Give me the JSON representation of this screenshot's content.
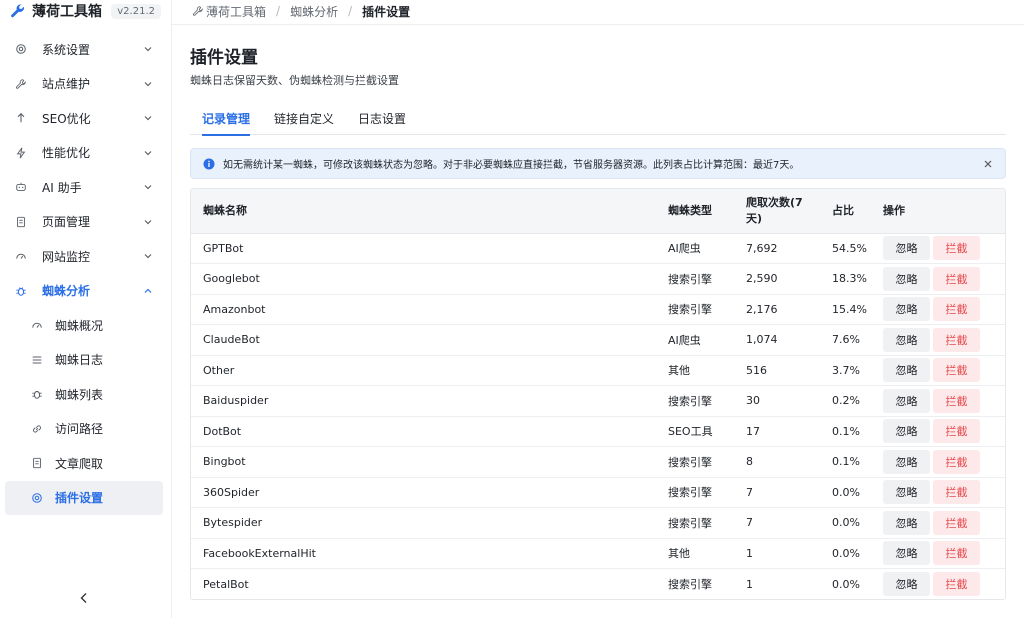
{
  "app": {
    "title": "薄荷工具箱",
    "version": "v2.21.2"
  },
  "sidebar": {
    "items": [
      {
        "label": "系统设置",
        "icon": "gear-icon"
      },
      {
        "label": "站点维护",
        "icon": "wrench-icon"
      },
      {
        "label": "SEO优化",
        "icon": "arrow-up-icon"
      },
      {
        "label": "性能优化",
        "icon": "bolt-icon"
      },
      {
        "label": "AI 助手",
        "icon": "robot-icon"
      },
      {
        "label": "页面管理",
        "icon": "page-icon"
      },
      {
        "label": "网站监控",
        "icon": "gauge-icon"
      },
      {
        "label": "蜘蛛分析",
        "icon": "bug-icon"
      }
    ],
    "sub_items": [
      {
        "label": "蜘蛛概况",
        "icon": "gauge-icon"
      },
      {
        "label": "蜘蛛日志",
        "icon": "list-icon"
      },
      {
        "label": "蜘蛛列表",
        "icon": "bug-icon"
      },
      {
        "label": "访问路径",
        "icon": "link-icon"
      },
      {
        "label": "文章爬取",
        "icon": "document-icon"
      },
      {
        "label": "插件设置",
        "icon": "gear-icon"
      }
    ]
  },
  "breadcrumb": {
    "root": "薄荷工具箱",
    "parent": "蜘蛛分析",
    "current": "插件设置"
  },
  "page": {
    "title": "插件设置",
    "subtitle": "蜘蛛日志保留天数、伪蜘蛛检测与拦截设置"
  },
  "tabs": [
    "记录管理",
    "链接自定义",
    "日志设置"
  ],
  "notice": "如无需统计某一蜘蛛，可修改该蜘蛛状态为忽略。对于非必要蜘蛛应直接拦截，节省服务器资源。此列表占比计算范围：最近7天。",
  "table": {
    "headers": {
      "name": "蜘蛛名称",
      "type": "蜘蛛类型",
      "count": "爬取次数(7天)",
      "ratio": "占比",
      "ops": "操作"
    },
    "ignore_label": "忽略",
    "block_label": "拦截",
    "rows": [
      {
        "name": "GPTBot",
        "type": "AI爬虫",
        "count": "7,692",
        "ratio": "54.5%"
      },
      {
        "name": "Googlebot",
        "type": "搜索引擎",
        "count": "2,590",
        "ratio": "18.3%"
      },
      {
        "name": "Amazonbot",
        "type": "搜索引擎",
        "count": "2,176",
        "ratio": "15.4%"
      },
      {
        "name": "ClaudeBot",
        "type": "AI爬虫",
        "count": "1,074",
        "ratio": "7.6%"
      },
      {
        "name": "Other",
        "type": "其他",
        "count": "516",
        "ratio": "3.7%"
      },
      {
        "name": "Baiduspider",
        "type": "搜索引擎",
        "count": "30",
        "ratio": "0.2%"
      },
      {
        "name": "DotBot",
        "type": "SEO工具",
        "count": "17",
        "ratio": "0.1%"
      },
      {
        "name": "Bingbot",
        "type": "搜索引擎",
        "count": "8",
        "ratio": "0.1%"
      },
      {
        "name": "360Spider",
        "type": "搜索引擎",
        "count": "7",
        "ratio": "0.0%"
      },
      {
        "name": "Bytespider",
        "type": "搜索引擎",
        "count": "7",
        "ratio": "0.0%"
      },
      {
        "name": "FacebookExternalHit",
        "type": "其他",
        "count": "1",
        "ratio": "0.0%"
      },
      {
        "name": "PetalBot",
        "type": "搜索引擎",
        "count": "1",
        "ratio": "0.0%"
      }
    ]
  },
  "colors": {
    "accent": "#2b6fe6",
    "danger": "#e5484d",
    "notice_bg": "#e8f1fc"
  }
}
